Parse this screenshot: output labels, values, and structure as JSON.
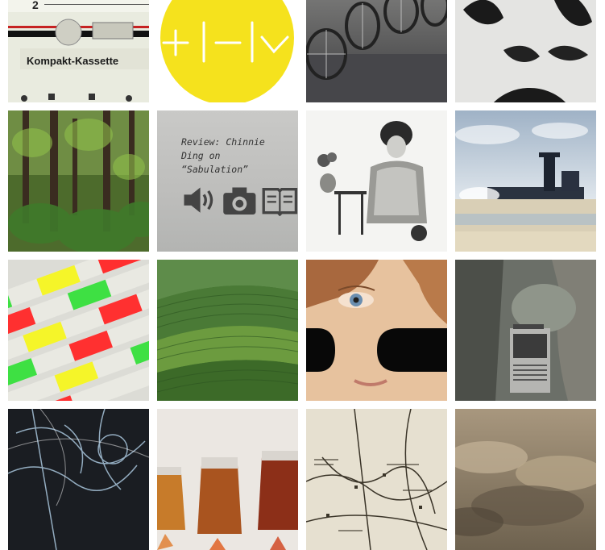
{
  "tiles": [
    {
      "name": "tile-cassette",
      "kind": "cassette",
      "label": "Kompakt-Kassette",
      "number": "2"
    },
    {
      "name": "tile-yellow-logo",
      "kind": "logo"
    },
    {
      "name": "tile-wheelchairs",
      "kind": "photo"
    },
    {
      "name": "tile-face-print",
      "kind": "photo"
    },
    {
      "name": "tile-forest",
      "kind": "photo"
    },
    {
      "name": "tile-review",
      "kind": "review",
      "line1": "Review: Chinnie",
      "line2": "Ding on",
      "line3": "“Sabulation”",
      "icons": [
        "speaker-icon",
        "camera-icon",
        "book-icon"
      ]
    },
    {
      "name": "tile-victorian-woman",
      "kind": "photo"
    },
    {
      "name": "tile-industrial-beach",
      "kind": "photo"
    },
    {
      "name": "tile-lottery-tickets",
      "kind": "photo"
    },
    {
      "name": "tile-tea-fields",
      "kind": "photo"
    },
    {
      "name": "tile-painted-face",
      "kind": "photo"
    },
    {
      "name": "tile-cassette-player",
      "kind": "photo"
    },
    {
      "name": "tile-chalk-lines",
      "kind": "photo"
    },
    {
      "name": "tile-whiskey-glasses",
      "kind": "photo"
    },
    {
      "name": "tile-vintage-map",
      "kind": "photo"
    },
    {
      "name": "tile-sepia-clouds",
      "kind": "photo"
    }
  ],
  "colors": {
    "logo_yellow": "#f5e21d",
    "page_bg": "#ffffff"
  }
}
